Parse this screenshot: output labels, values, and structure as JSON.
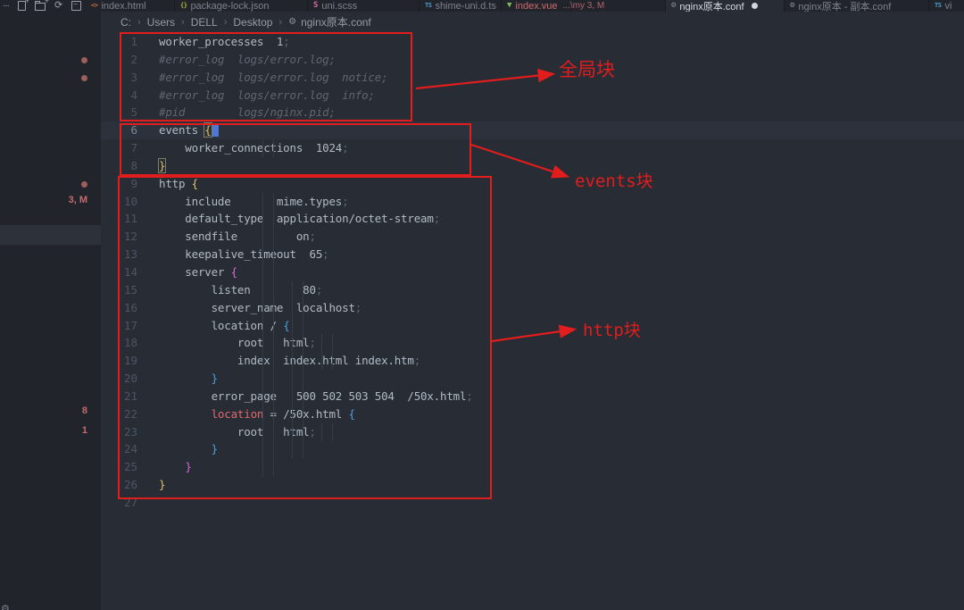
{
  "explorer_toolbar": {
    "icons": [
      "more-actions",
      "new-file",
      "new-folder",
      "refresh-explorer",
      "collapse-folders"
    ]
  },
  "tabs": [
    {
      "label": "index.html",
      "icon": "html-icon",
      "glyph": "<>",
      "icon_color": "#d1693f"
    },
    {
      "label": "package-lock.json",
      "icon": "json-icon",
      "glyph": "{}",
      "icon_color": "#b7b73b"
    },
    {
      "label": "uni.scss",
      "icon": "scss-icon",
      "glyph": "S",
      "icon_color": "#d569a6"
    },
    {
      "label": "shime-uni.d.ts",
      "icon": "ts-icon",
      "glyph": "TS",
      "icon_color": "#4e9fcf"
    },
    {
      "label": "index.vue",
      "sublabel": "...\\my 3, M",
      "icon": "vue-icon",
      "glyph": "▼",
      "icon_color": "#7abf5a",
      "modified_red": true
    },
    {
      "label": "nginx原本.conf",
      "icon": "gear-icon",
      "glyph": "⚙",
      "icon_color": "#8a919d",
      "active": true,
      "dirty": true
    },
    {
      "label": "nginx原本 - 副本.conf",
      "icon": "gear-icon",
      "glyph": "⚙",
      "icon_color": "#8a919d"
    },
    {
      "label": "vi",
      "icon": "ts-icon",
      "glyph": "TS",
      "icon_color": "#4e9fcf"
    }
  ],
  "breadcrumb": {
    "separator": "›",
    "items": [
      {
        "text": "C:"
      },
      {
        "text": "Users"
      },
      {
        "text": "DELL"
      },
      {
        "text": "Desktop"
      },
      {
        "text": "nginx原本.conf",
        "icon": "gear-icon",
        "glyph": "⚙"
      }
    ]
  },
  "sidebar": {
    "badges": [
      {
        "text": "3, M"
      },
      {
        "text": "8"
      },
      {
        "text": "1"
      }
    ]
  },
  "editor": {
    "cursor_line": 6,
    "lines": [
      {
        "n": 1,
        "s": [
          [
            "d",
            "worker_processes  1"
          ],
          [
            "s",
            ";"
          ]
        ]
      },
      {
        "n": 2,
        "s": [
          [
            "c",
            "#error_log  logs/error.log;"
          ]
        ]
      },
      {
        "n": 3,
        "s": [
          [
            "c",
            "#error_log  logs/error.log  notice;"
          ]
        ]
      },
      {
        "n": 4,
        "s": [
          [
            "c",
            "#error_log  logs/error.log  info;"
          ]
        ]
      },
      {
        "n": 5,
        "s": [
          [
            "c",
            "#pid        logs/nginx.pid;"
          ]
        ]
      },
      {
        "n": 6,
        "s": [
          [
            "d",
            "events "
          ],
          [
            "ym",
            "{"
          ],
          [
            "cursor",
            ""
          ]
        ]
      },
      {
        "n": 7,
        "s": [
          [
            "d",
            "    worker_connections  1024"
          ],
          [
            "s",
            ";"
          ]
        ]
      },
      {
        "n": 8,
        "s": [
          [
            "ym",
            "}"
          ]
        ]
      },
      {
        "n": 9,
        "s": [
          [
            "d",
            "http "
          ],
          [
            "y",
            "{"
          ]
        ]
      },
      {
        "n": 10,
        "s": [
          [
            "d",
            "    include       mime.types"
          ],
          [
            "s",
            ";"
          ]
        ]
      },
      {
        "n": 11,
        "s": [
          [
            "d",
            "    default_type  application/octet-stream"
          ],
          [
            "s",
            ";"
          ]
        ]
      },
      {
        "n": 12,
        "s": [
          [
            "d",
            "    sendfile         on"
          ],
          [
            "s",
            ";"
          ]
        ]
      },
      {
        "n": 13,
        "s": [
          [
            "d",
            "    keepalive_timeout  65"
          ],
          [
            "s",
            ";"
          ]
        ]
      },
      {
        "n": 14,
        "s": [
          [
            "d",
            "    server "
          ],
          [
            "p",
            "{"
          ]
        ]
      },
      {
        "n": 15,
        "s": [
          [
            "d",
            "        listen        80"
          ],
          [
            "s",
            ";"
          ]
        ]
      },
      {
        "n": 16,
        "s": [
          [
            "d",
            "        server_name  localhost"
          ],
          [
            "s",
            ";"
          ]
        ]
      },
      {
        "n": 17,
        "s": [
          [
            "d",
            "        location / "
          ],
          [
            "b",
            "{"
          ]
        ]
      },
      {
        "n": 18,
        "s": [
          [
            "d",
            "            root   html"
          ],
          [
            "s",
            ";"
          ]
        ]
      },
      {
        "n": 19,
        "s": [
          [
            "d",
            "            index  index.html index.htm"
          ],
          [
            "s",
            ";"
          ]
        ]
      },
      {
        "n": 20,
        "s": [
          [
            "d",
            "        "
          ],
          [
            "b",
            "}"
          ]
        ]
      },
      {
        "n": 21,
        "s": [
          [
            "d",
            "        error_page   500 502 503 504  /50x.html"
          ],
          [
            "s",
            ";"
          ]
        ]
      },
      {
        "n": 22,
        "s": [
          [
            "d",
            "        "
          ],
          [
            "r",
            "location"
          ],
          [
            "d",
            " = /50x.html "
          ],
          [
            "b",
            "{"
          ]
        ]
      },
      {
        "n": 23,
        "s": [
          [
            "d",
            "            root   html"
          ],
          [
            "s",
            ";"
          ]
        ]
      },
      {
        "n": 24,
        "s": [
          [
            "d",
            "        "
          ],
          [
            "b",
            "}"
          ]
        ]
      },
      {
        "n": 25,
        "s": [
          [
            "d",
            "    "
          ],
          [
            "p",
            "}"
          ]
        ]
      },
      {
        "n": 26,
        "s": [
          [
            "y",
            "}"
          ]
        ]
      },
      {
        "n": 27,
        "s": []
      }
    ]
  },
  "annotations": {
    "labels": [
      {
        "text": "全局块"
      },
      {
        "text": "events块"
      },
      {
        "text": "http块"
      }
    ]
  },
  "colors": {
    "annotation_red": "#e11d1d",
    "editor_bg": "#282c34",
    "panel_bg": "#21252b",
    "accent_cursor": "#4d78d8"
  }
}
